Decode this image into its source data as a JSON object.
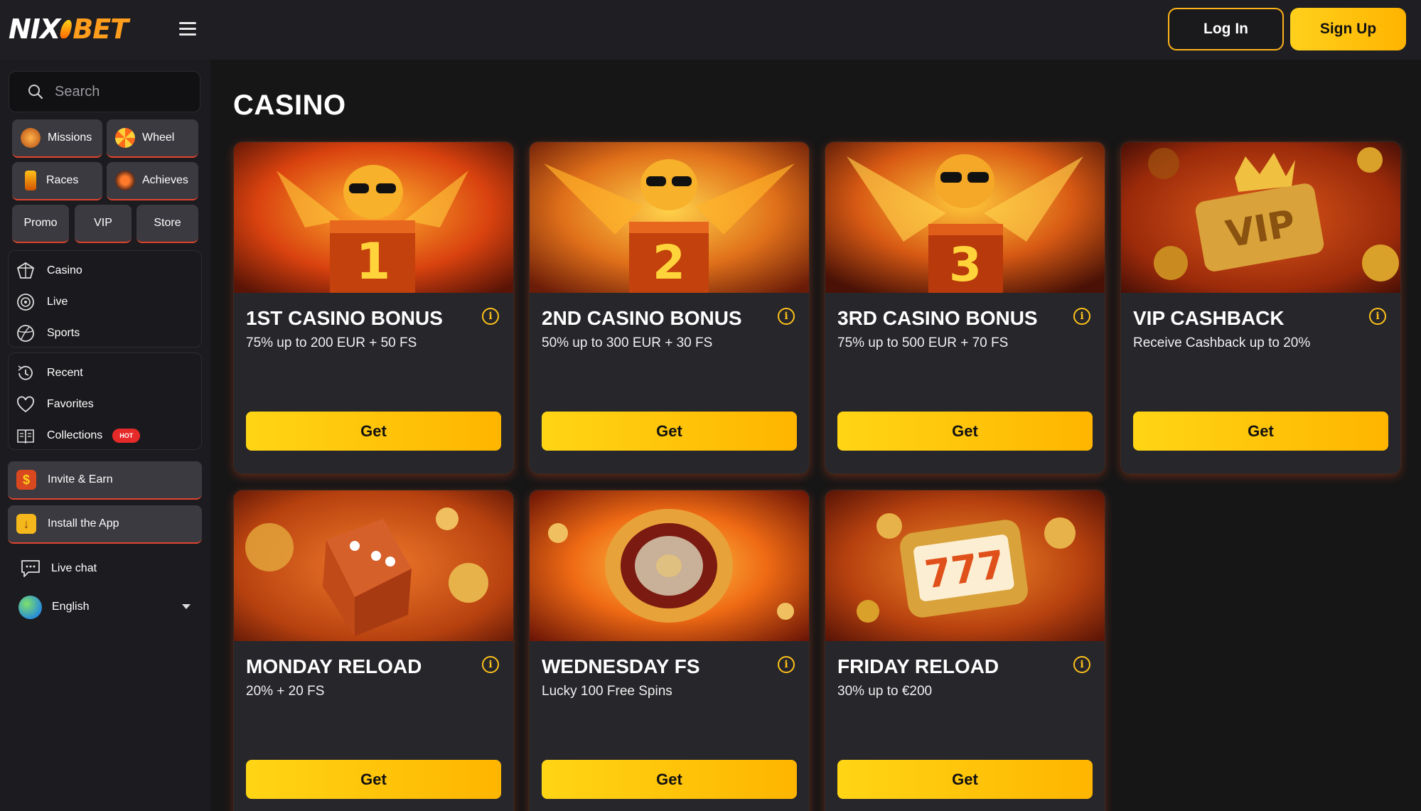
{
  "header": {
    "logo_left": "NIX",
    "logo_right": "BET",
    "login_label": "Log In",
    "signup_label": "Sign Up"
  },
  "sidebar": {
    "search_placeholder": "Search",
    "chips": [
      {
        "label": "Missions",
        "icon": "missions-icon"
      },
      {
        "label": "Wheel",
        "icon": "wheel-icon"
      },
      {
        "label": "Races",
        "icon": "races-icon"
      },
      {
        "label": "Achieves",
        "icon": "achieves-icon"
      },
      {
        "label": "Promo"
      },
      {
        "label": "VIP"
      },
      {
        "label": "Store"
      }
    ],
    "main_nav": [
      {
        "label": "Casino",
        "icon": "casino-icon"
      },
      {
        "label": "Live",
        "icon": "live-icon"
      },
      {
        "label": "Sports",
        "icon": "sports-icon"
      }
    ],
    "library_nav": [
      {
        "label": "Recent",
        "icon": "recent-icon"
      },
      {
        "label": "Favorites",
        "icon": "heart-icon"
      },
      {
        "label": "Collections",
        "icon": "book-icon",
        "badge": "HOT"
      }
    ],
    "invite_label": "Invite & Earn",
    "install_label": "Install the App",
    "live_chat_label": "Live chat",
    "language": "English"
  },
  "main": {
    "title": "CASINO",
    "get_label": "Get",
    "cards": [
      {
        "title": "1ST CASINO BONUS",
        "subtitle": "75% up to 200 EUR + 50 FS",
        "number": "1"
      },
      {
        "title": "2ND CASINO BONUS",
        "subtitle": "50% up to 300 EUR + 30 FS",
        "number": "2"
      },
      {
        "title": "3RD CASINO BONUS",
        "subtitle": "75% up to 500 EUR + 70 FS",
        "number": "3"
      },
      {
        "title": "VIP CASHBACK",
        "subtitle": "Receive Cashback up to 20%",
        "image_text": "VIP"
      },
      {
        "title": "MONDAY RELOAD",
        "subtitle": "20% + 20 FS"
      },
      {
        "title": "WEDNESDAY FS",
        "subtitle": "Lucky 100 Free Spins"
      },
      {
        "title": "FRIDAY RELOAD",
        "subtitle": "30% up to €200",
        "image_text": "777"
      }
    ]
  },
  "colors": {
    "accent": "#ffc21a",
    "background": "#161617",
    "card": "#26262b",
    "hot_badge": "#e62a2a"
  }
}
